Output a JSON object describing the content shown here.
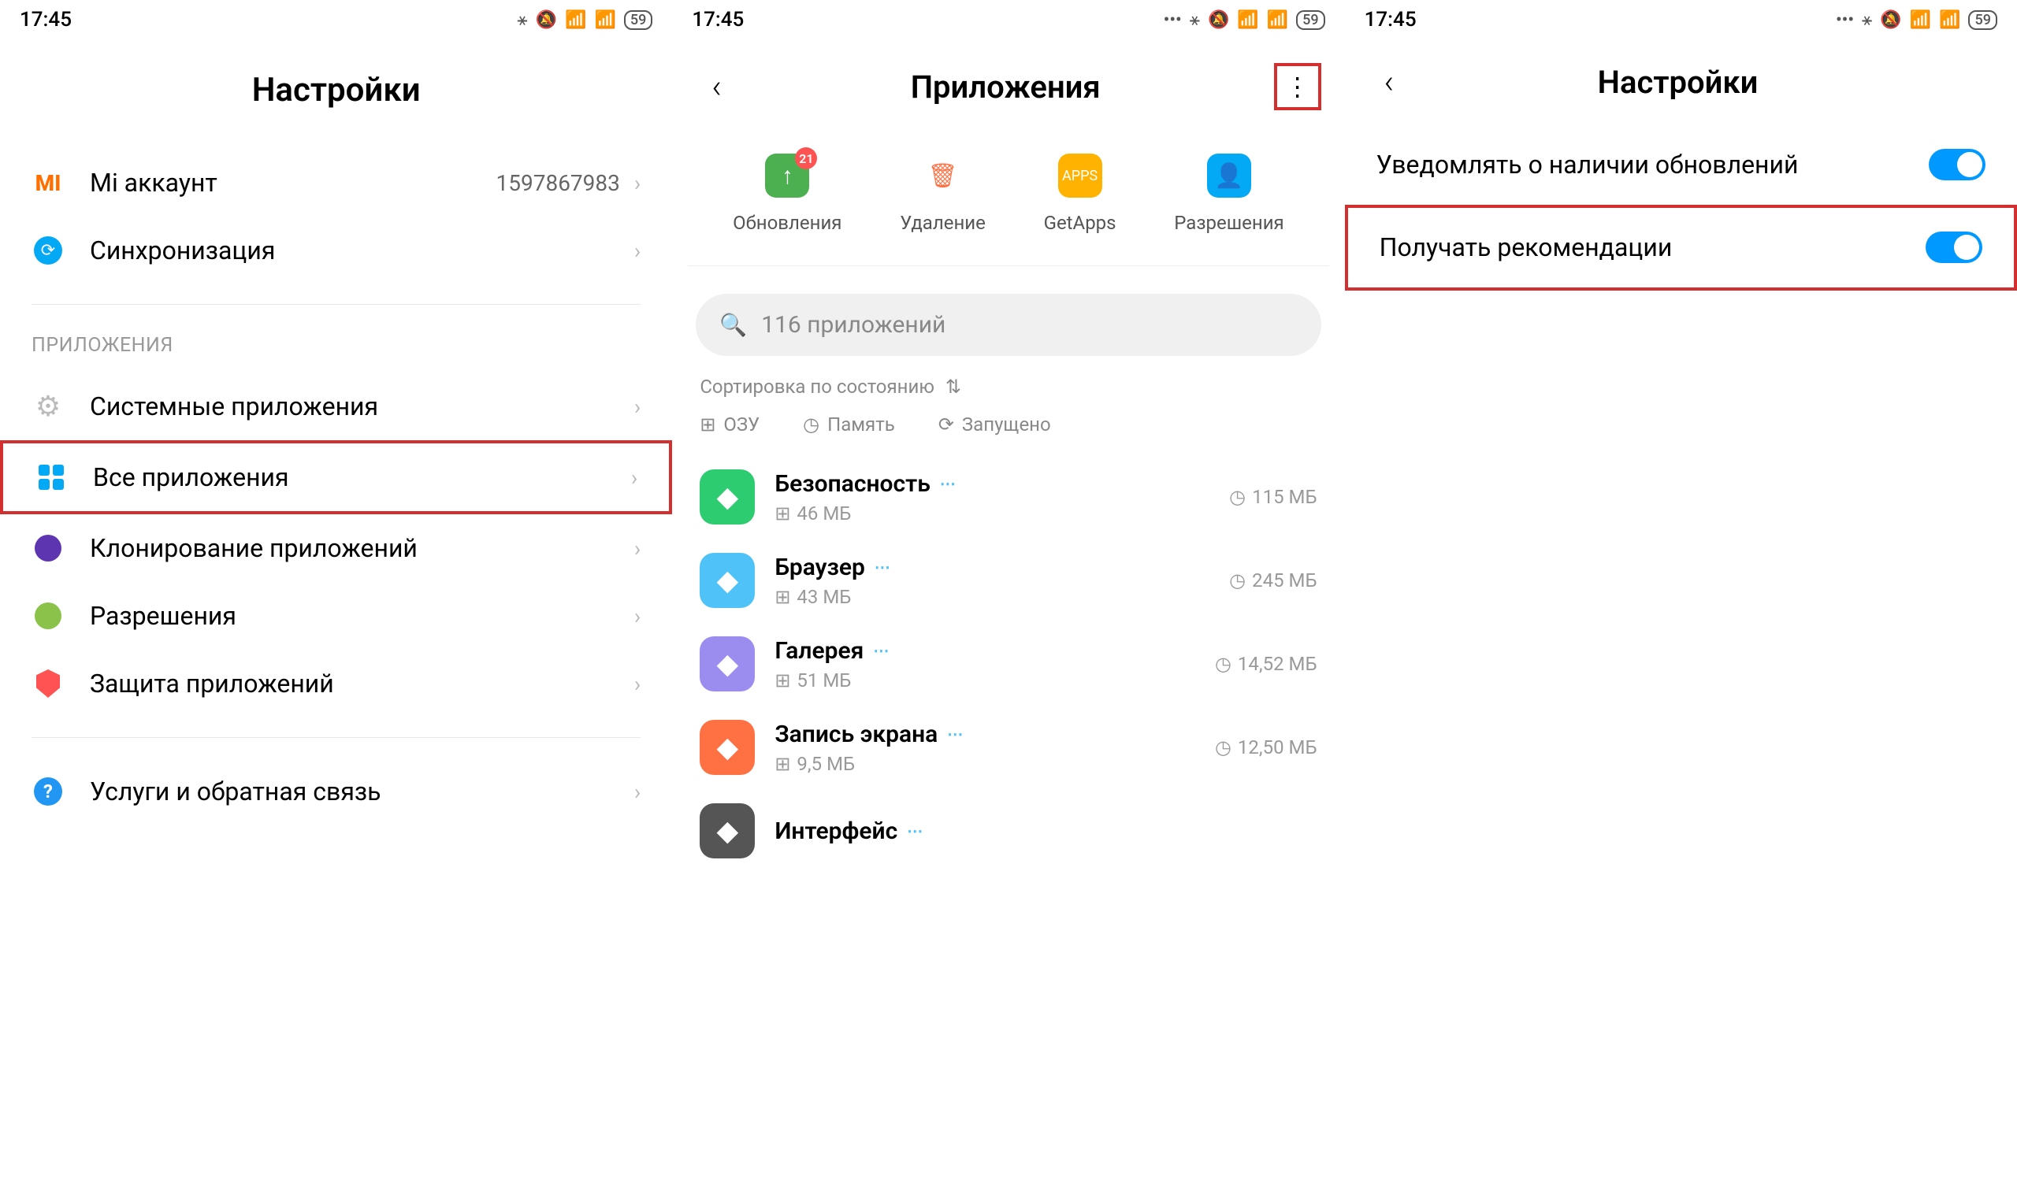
{
  "status": {
    "time": "17:45",
    "battery": "59"
  },
  "screen1": {
    "title": "Настройки",
    "account": {
      "label": "Mi аккаунт",
      "value": "1597867983"
    },
    "sync": {
      "label": "Синхронизация"
    },
    "section": "ПРИЛОЖЕНИЯ",
    "items": [
      {
        "label": "Системные приложения"
      },
      {
        "label": "Все приложения"
      },
      {
        "label": "Клонирование приложений"
      },
      {
        "label": "Разрешения"
      },
      {
        "label": "Защита приложений"
      }
    ],
    "support": {
      "label": "Услуги и обратная связь"
    }
  },
  "screen2": {
    "title": "Приложения",
    "top_actions": [
      {
        "label": "Обновления",
        "badge": "21"
      },
      {
        "label": "Удаление"
      },
      {
        "label": "GetApps"
      },
      {
        "label": "Разрешения"
      }
    ],
    "search_placeholder": "116 приложений",
    "sort": "Сортировка по состоянию",
    "filters": [
      "ОЗУ",
      "Память",
      "Запущено"
    ],
    "apps": [
      {
        "name": "Безопасность",
        "ram": "46 МБ",
        "storage": "115 МБ",
        "icon_bg": "#2ecc71"
      },
      {
        "name": "Браузер",
        "ram": "43 МБ",
        "storage": "245 МБ",
        "icon_bg": "#4fc3f7"
      },
      {
        "name": "Галерея",
        "ram": "51 МБ",
        "storage": "14,52 МБ",
        "icon_bg": "#9b8cf0"
      },
      {
        "name": "Запись экрана",
        "ram": "9,5 МБ",
        "storage": "12,50 МБ",
        "icon_bg": "#ff7043"
      },
      {
        "name": "Интерфейс",
        "ram": "",
        "storage": "",
        "icon_bg": "#555"
      }
    ]
  },
  "screen3": {
    "title": "Настройки",
    "toggles": [
      {
        "label": "Уведомлять о наличии обновлений",
        "on": true
      },
      {
        "label": "Получать рекомендации",
        "on": true
      }
    ]
  }
}
